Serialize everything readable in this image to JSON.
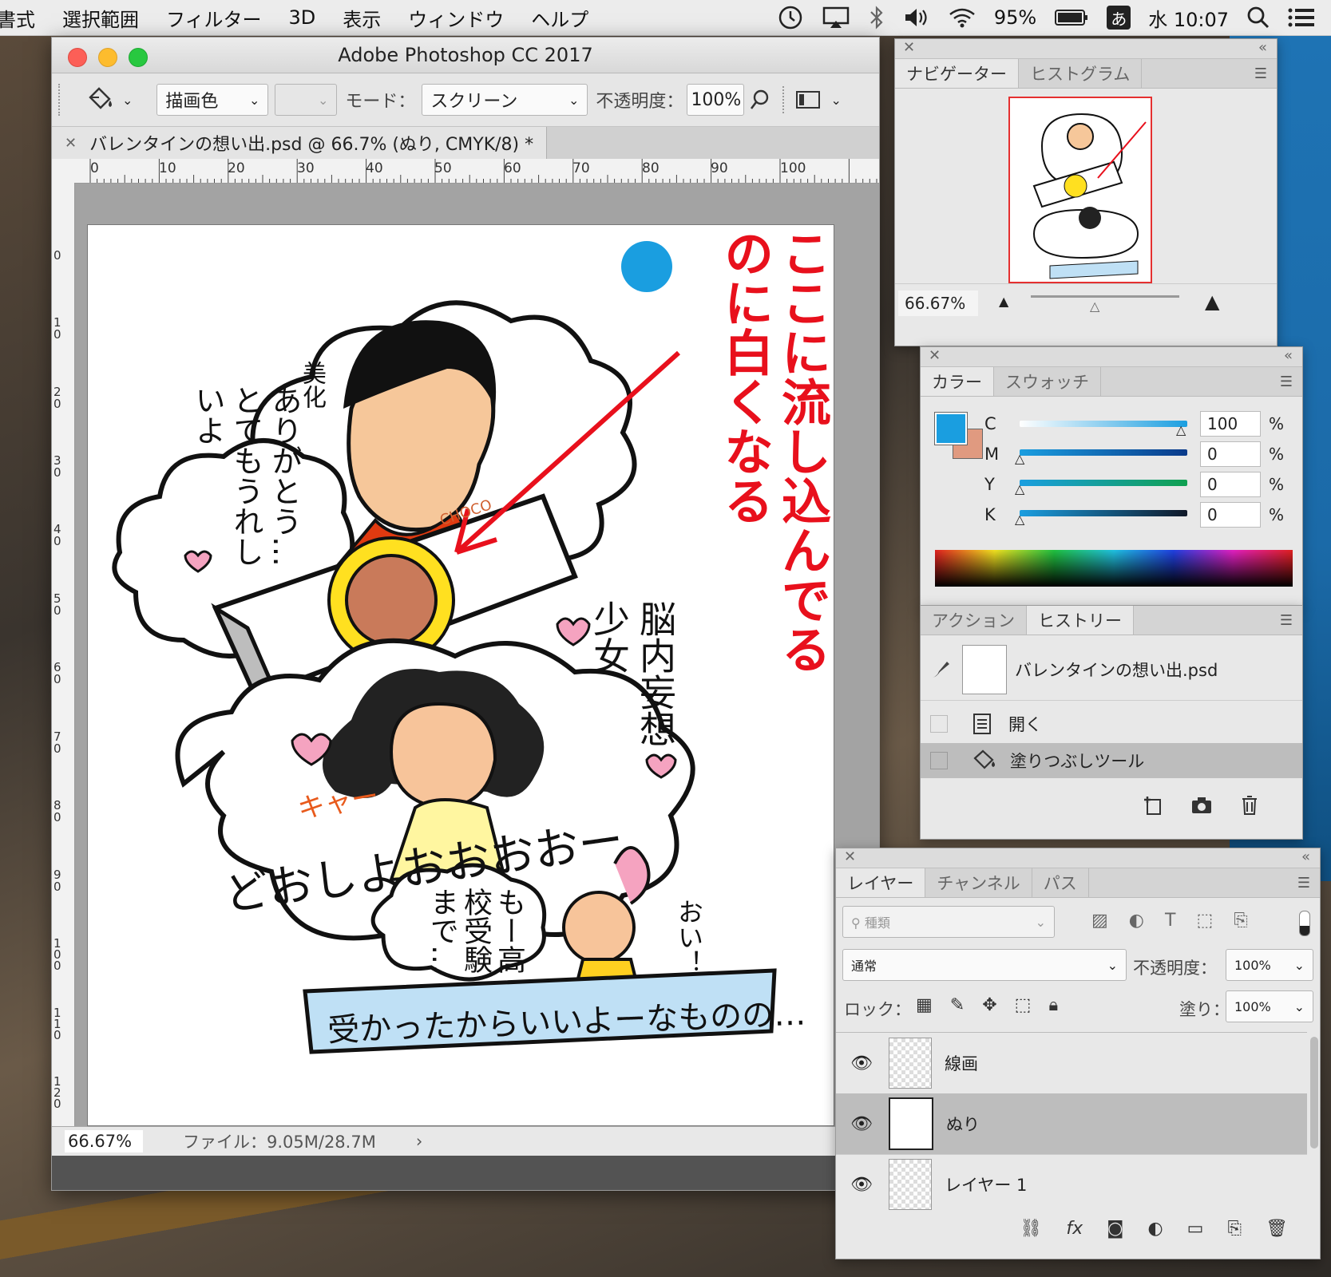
{
  "menubar": {
    "items": [
      "書式",
      "選択範囲",
      "フィルター",
      "3D",
      "表示",
      "ウィンドウ",
      "ヘルプ"
    ],
    "battery": "95%",
    "ime": "あ",
    "clock": "水 10:07"
  },
  "window": {
    "title": "Adobe Photoshop CC 2017",
    "options": {
      "fill_source": "描画色",
      "mode_label": "モード：",
      "mode_value": "スクリーン",
      "opacity_label": "不透明度：",
      "opacity_value": "100%"
    },
    "doc_tab": "バレンタインの想い出.psd @ 66.7% (ぬり, CMYK/8) *",
    "ruler_h": [
      "0",
      "10",
      "20",
      "30",
      "40",
      "50",
      "60",
      "70",
      "80",
      "90",
      "100"
    ],
    "ruler_v": [
      "0",
      "10",
      "20",
      "30",
      "40",
      "50",
      "60",
      "70",
      "80",
      "90",
      "100",
      "110",
      "120"
    ],
    "status": {
      "zoom": "66.67%",
      "file": "ファイル：9.05M/28.7M"
    }
  },
  "artwork": {
    "red_note": "ここに流し込んでるのに白くなる",
    "bubble_left": "ありがとう… とてもうれしいよ",
    "bubble_label": "美化",
    "girl_label": "脳内妄想少女",
    "shout": "どおしよおおおおー",
    "kya": "キャー",
    "bottom_bubble": "もー高校受験まで…",
    "rabbit": "おい！",
    "banner": "受かったからいいよーなものの…",
    "choco": "CHOCO"
  },
  "navigator": {
    "tabs": [
      "ナビゲーター",
      "ヒストグラム"
    ],
    "zoom": "66.67%"
  },
  "color_panel": {
    "tabs": [
      "カラー",
      "スウォッチ"
    ],
    "channels": [
      {
        "label": "C",
        "value": "100",
        "unit": "%",
        "level": 1.0
      },
      {
        "label": "M",
        "value": "0",
        "unit": "%",
        "level": 0.0
      },
      {
        "label": "Y",
        "value": "0",
        "unit": "%",
        "level": 0.0
      },
      {
        "label": "K",
        "value": "0",
        "unit": "%",
        "level": 0.0
      }
    ],
    "fg_color": "#1a9ee0",
    "bg_color": "#e09a80"
  },
  "history_panel": {
    "tabs": [
      "アクション",
      "ヒストリー"
    ],
    "snapshot": "バレンタインの想い出.psd",
    "states": [
      "開く",
      "塗りつぶしツール"
    ]
  },
  "layers_panel": {
    "tabs": [
      "レイヤー",
      "チャンネル",
      "パス"
    ],
    "filter_placeholder": "種類",
    "blend_mode": "通常",
    "opacity_label": "不透明度：",
    "opacity_value": "100%",
    "lock_label": "ロック：",
    "fill_label": "塗り：",
    "fill_value": "100%",
    "layers": [
      {
        "name": "線画",
        "selected": false
      },
      {
        "name": "ぬり",
        "selected": true
      },
      {
        "name": "レイヤー 1",
        "selected": false
      }
    ]
  },
  "colors": {
    "accent_blue": "#1a9ee0",
    "red_ink": "#e8101c",
    "selected_row": "#bdbdbd"
  }
}
